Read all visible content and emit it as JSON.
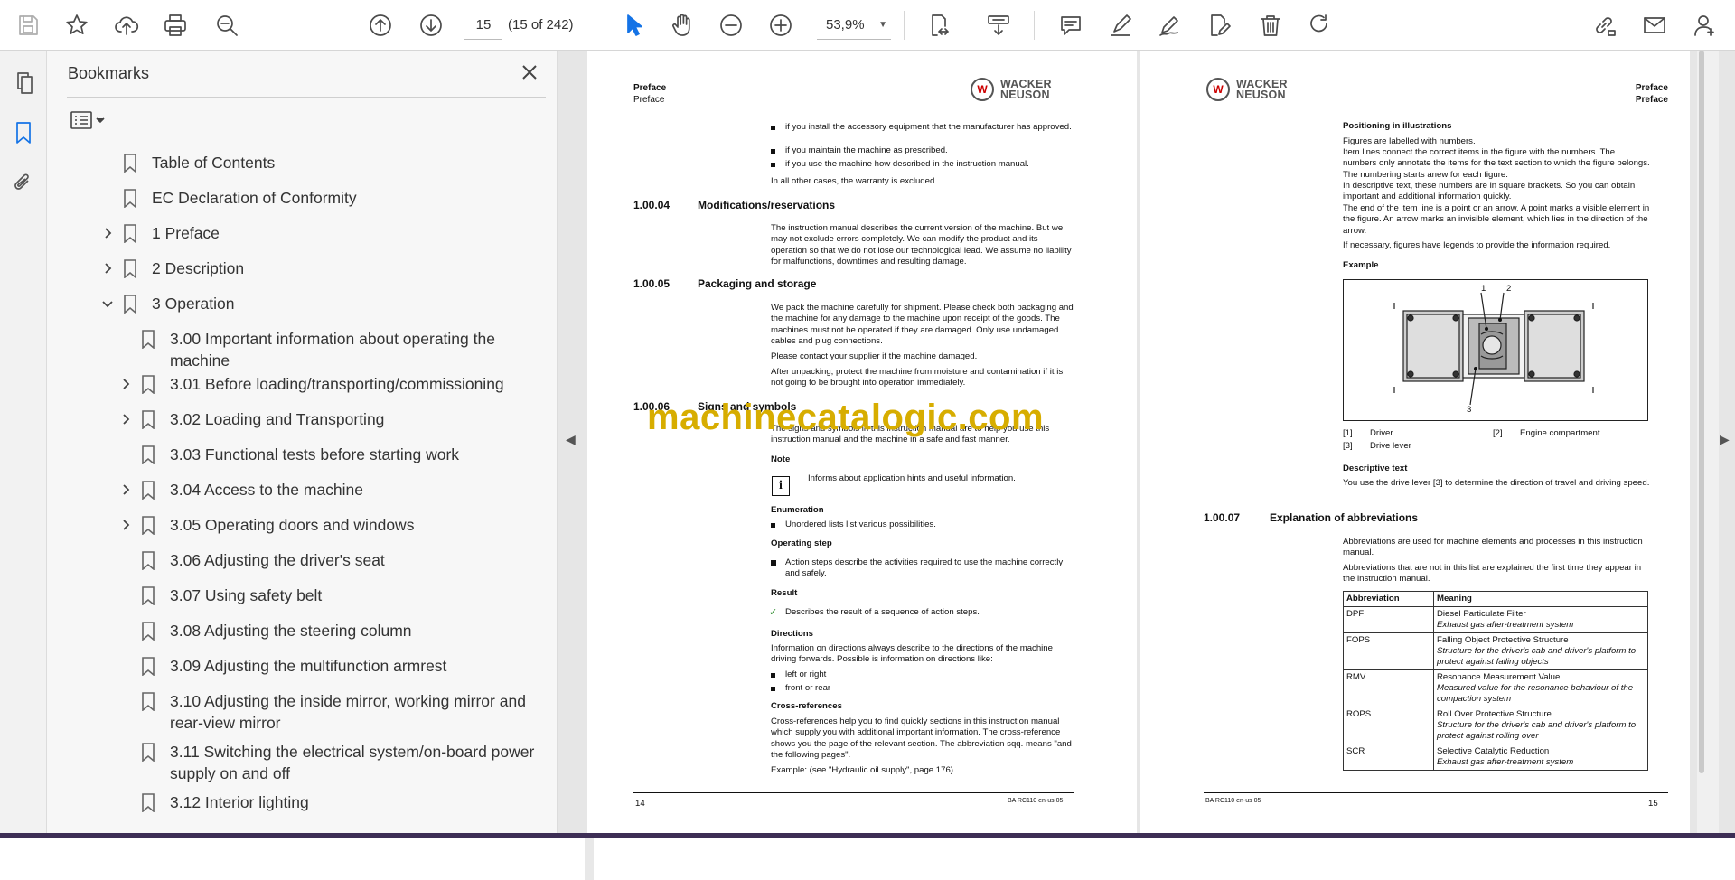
{
  "toolbar": {
    "page_number": "15",
    "page_count": "(15 of 242)",
    "zoom": "53,9%"
  },
  "bookmarks_panel": {
    "title": "Bookmarks",
    "items": [
      {
        "label": "Table of Contents",
        "expander": "none",
        "level": 0
      },
      {
        "label": "EC Declaration of Conformity",
        "expander": "none",
        "level": 0
      },
      {
        "label": "1 Preface",
        "expander": "collapsed",
        "level": 0
      },
      {
        "label": "2 Description",
        "expander": "collapsed",
        "level": 0
      },
      {
        "label": "3 Operation",
        "expander": "expanded",
        "level": 0
      },
      {
        "label": "3.00 Important information about operating the machine",
        "expander": "none",
        "level": 1
      },
      {
        "label": "3.01 Before loading/transporting/commissioning",
        "expander": "collapsed",
        "level": 1
      },
      {
        "label": "3.02 Loading and Transporting",
        "expander": "collapsed",
        "level": 1
      },
      {
        "label": "3.03 Functional tests before starting work",
        "expander": "none",
        "level": 1
      },
      {
        "label": "3.04 Access to the machine",
        "expander": "collapsed",
        "level": 1
      },
      {
        "label": "3.05 Operating doors and windows",
        "expander": "collapsed",
        "level": 1
      },
      {
        "label": "3.06 Adjusting the driver's seat",
        "expander": "none",
        "level": 1
      },
      {
        "label": "3.07 Using safety belt",
        "expander": "none",
        "level": 1
      },
      {
        "label": "3.08 Adjusting the steering column",
        "expander": "none",
        "level": 1
      },
      {
        "label": "3.09 Adjusting the multifunction armrest",
        "expander": "none",
        "level": 1
      },
      {
        "label": "3.10 Adjusting the inside mirror, working mirror and rear-view mirror",
        "expander": "none",
        "level": 1
      },
      {
        "label": "3.11 Switching the electrical system/on-board power supply on and off",
        "expander": "none",
        "level": 1
      },
      {
        "label": "3.12 Interior lighting",
        "expander": "none",
        "level": 1
      }
    ]
  },
  "watermark": "machinecatalogic.com",
  "page_left": {
    "header_1": "Preface",
    "header_2": "Preface",
    "logo_line1": "WACKER",
    "logo_line2": "NEUSON",
    "bullets_top": [
      "if you install the accessory equipment that the manufacturer has approved.",
      "if you maintain the machine as prescribed.",
      "if you use the machine how described in the instruction manual."
    ],
    "other_cases": "In all other cases, the warranty is excluded.",
    "s1_num": "1.00.04",
    "s1_title": "Modifications/reservations",
    "s1_text": "The instruction manual describes the current version of the machine. But we may not exclude errors completely. We can modify the product and its operation so that we do not lose our technological lead. We assume no liability for malfunctions, downtimes and resulting damage.",
    "s2_num": "1.00.05",
    "s2_title": "Packaging and storage",
    "s2_text1": "We pack the machine carefully for shipment. Please check both packaging and the machine for any damage to the machine upon receipt of the goods. The machines must not be operated if they are damaged. Only use undamaged cables and plug connections.",
    "s2_text2": "Please contact your supplier if the machine damaged.",
    "s2_text3": "After unpacking, protect the machine from moisture and contamination if it is not going to be brought into operation immediately.",
    "s3_num": "1.00.06",
    "s3_title": "Signs and symbols",
    "s3_text": "The signs and symbols in this instruction manual are to help you use this instruction manual and the machine in a safe and fast manner.",
    "note_h": "Note",
    "note_text": "Informs about application hints and useful information.",
    "enum_h": "Enumeration",
    "enum_text": "Unordered lists list various possibilities.",
    "op_h": "Operating step",
    "op_text": "Action steps describe the activities required to use the machine correctly and safely.",
    "res_h": "Result",
    "res_text": "Describes the result of a sequence of action steps.",
    "dir_h": "Directions",
    "dir_text": "Information on directions always describe to the directions of the machine driving forwards. Possible is information on directions like:",
    "dir_b1": "left or right",
    "dir_b2": "front or rear",
    "xref_h": "Cross-references",
    "xref_text": "Cross-references help you to find quickly sections in this instruction manual which supply you with additional important information. The cross-reference shows you the page of the relevant section. The abbreviation sqq. means \"and the following pages\".",
    "xref_example": "Example: (see \"Hydraulic oil supply\", page 176)",
    "footer_num": "14",
    "footer_doc": "BA RC110 en-us 05"
  },
  "page_right": {
    "header_1": "Preface",
    "header_2": "Preface",
    "logo_line1": "WACKER",
    "logo_line2": "NEUSON",
    "pos_h": "Positioning in illustrations",
    "pos_text1": "Figures are labelled with numbers.",
    "pos_text2": "Item lines connect the correct items in the figure with the numbers. The numbers only annotate the items for the text section to which the figure belongs. The numbering starts anew for each figure.",
    "pos_text3": "In descriptive text, these numbers are in square brackets. So you can obtain important and additional information quickly.",
    "pos_text4": "The end of the item line is a point or an arrow. A point marks a visible element in the figure. An arrow marks an invisible element, which lies in the direction of the arrow.",
    "pos_text5": "If necessary, figures have legends to provide the information required.",
    "example_h": "Example",
    "fig_n1": "1",
    "fig_n2": "2",
    "fig_n3": "3",
    "legend": [
      {
        "num": "[1]",
        "text": "Driver"
      },
      {
        "num": "[2]",
        "text": "Engine compartment"
      },
      {
        "num": "[3]",
        "text": "Drive lever"
      }
    ],
    "desc_h": "Descriptive text",
    "desc_text": "You use the drive lever [3] to determine the direction of travel and driving speed.",
    "s_num": "1.00.07",
    "s_title": "Explanation of abbreviations",
    "abbr_text1": "Abbreviations are used for machine elements and processes in this instruction manual.",
    "abbr_text2": "Abbreviations that are not in this list are explained the first time they appear in the instruction manual.",
    "table_headers": [
      "Abbreviation",
      "Meaning"
    ],
    "table_rows": [
      {
        "abbr": "DPF",
        "meaning": "Diesel Particulate Filter",
        "detail": "Exhaust gas after-treatment system"
      },
      {
        "abbr": "FOPS",
        "meaning": "Falling Object Protective Structure",
        "detail": "Structure for the driver's cab and driver's platform to protect against falling objects"
      },
      {
        "abbr": "RMV",
        "meaning": "Resonance Measurement Value",
        "detail": "Measured value for the resonance behaviour of the compaction system"
      },
      {
        "abbr": "ROPS",
        "meaning": "Roll Over Protective Structure",
        "detail": "Structure for the driver's cab and driver's platform to protect against rolling over"
      },
      {
        "abbr": "SCR",
        "meaning": "Selective Catalytic Reduction",
        "detail": "Exhaust gas after-treatment system"
      }
    ],
    "footer_doc": "BA RC110 en-us 05",
    "footer_num": "15"
  }
}
